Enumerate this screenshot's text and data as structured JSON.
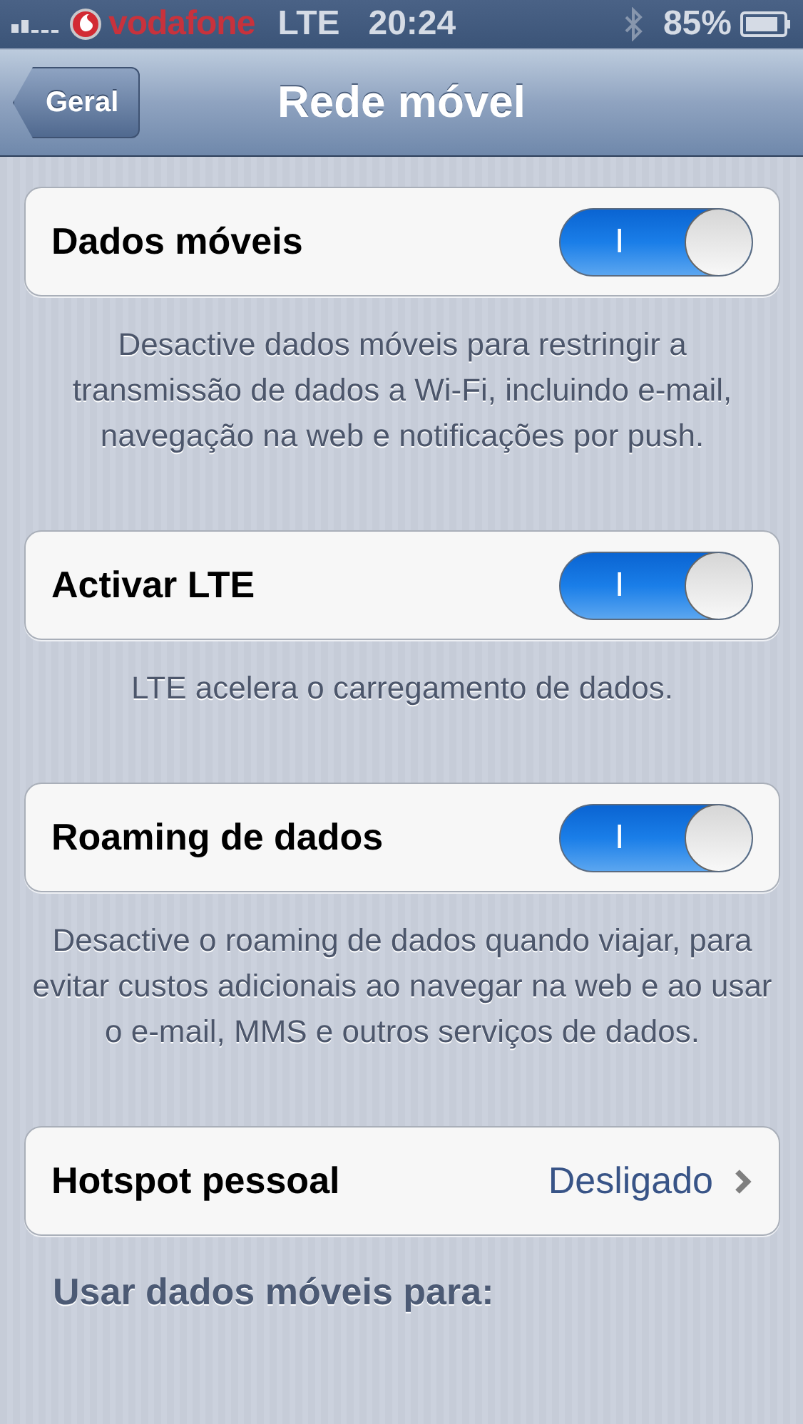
{
  "status_bar": {
    "carrier": "vodafone",
    "network": "LTE",
    "time": "20:24",
    "battery": "85%"
  },
  "nav_bar": {
    "back": "Geral",
    "title": "Rede móvel"
  },
  "sections": [
    {
      "kind": "switch",
      "label": "Dados móveis",
      "on": true,
      "switch_text": "I",
      "footer": "Desactive dados móveis para restringir a transmissão de dados a Wi-Fi, incluindo e-mail, navegação na web e notificações por push."
    },
    {
      "kind": "switch",
      "label": "Activar LTE",
      "on": true,
      "switch_text": "I",
      "footer": "LTE acelera o carregamento de dados."
    },
    {
      "kind": "switch",
      "label": "Roaming de dados",
      "on": true,
      "switch_text": "I",
      "footer": "Desactive o roaming de dados quando viajar, para evitar custos adicionais ao navegar na web e ao usar o e-mail, MMS e outros serviços de dados."
    },
    {
      "kind": "link",
      "label": "Hotspot pessoal",
      "value": "Desligado"
    }
  ],
  "group_header": "Usar dados móveis para:"
}
